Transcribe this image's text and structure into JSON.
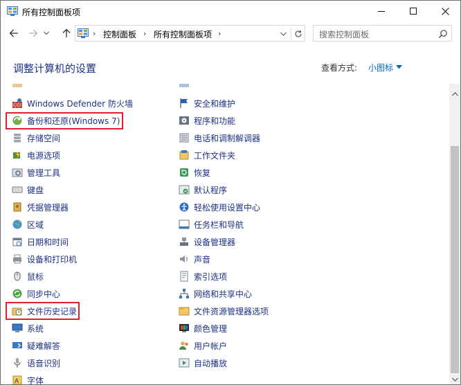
{
  "window": {
    "title": "所有控制面板项"
  },
  "address": {
    "crumbs": [
      "控制面板",
      "所有控制面板项"
    ],
    "search_placeholder": "搜索控制面板"
  },
  "header": {
    "heading": "调整计算机的设置",
    "view_by_label": "查看方式:",
    "view_by_value": "小图标"
  },
  "items_left": [
    {
      "label": "Windows Defender 防火墙",
      "icon": "firewall-icon"
    },
    {
      "label": "备份和还原(Windows 7)",
      "icon": "backup-restore-icon"
    },
    {
      "label": "存储空间",
      "icon": "storage-spaces-icon"
    },
    {
      "label": "电源选项",
      "icon": "power-options-icon"
    },
    {
      "label": "管理工具",
      "icon": "admin-tools-icon"
    },
    {
      "label": "键盘",
      "icon": "keyboard-icon"
    },
    {
      "label": "凭据管理器",
      "icon": "credential-manager-icon"
    },
    {
      "label": "区域",
      "icon": "region-icon"
    },
    {
      "label": "日期和时间",
      "icon": "date-time-icon"
    },
    {
      "label": "设备和打印机",
      "icon": "devices-printers-icon"
    },
    {
      "label": "鼠标",
      "icon": "mouse-icon"
    },
    {
      "label": "同步中心",
      "icon": "sync-center-icon"
    },
    {
      "label": "文件历史记录",
      "icon": "file-history-icon"
    },
    {
      "label": "系统",
      "icon": "system-icon"
    },
    {
      "label": "疑难解答",
      "icon": "troubleshooting-icon"
    },
    {
      "label": "语音识别",
      "icon": "speech-recognition-icon"
    },
    {
      "label": "字体",
      "icon": "fonts-icon"
    }
  ],
  "items_right": [
    {
      "label": "安全和维护",
      "icon": "security-maintenance-icon"
    },
    {
      "label": "程序和功能",
      "icon": "programs-features-icon"
    },
    {
      "label": "电话和调制解调器",
      "icon": "phone-modem-icon"
    },
    {
      "label": "工作文件夹",
      "icon": "work-folders-icon"
    },
    {
      "label": "恢复",
      "icon": "recovery-icon"
    },
    {
      "label": "默认程序",
      "icon": "default-programs-icon"
    },
    {
      "label": "轻松使用设置中心",
      "icon": "ease-of-access-icon"
    },
    {
      "label": "任务栏和导航",
      "icon": "taskbar-navigation-icon"
    },
    {
      "label": "设备管理器",
      "icon": "device-manager-icon"
    },
    {
      "label": "声音",
      "icon": "sound-icon"
    },
    {
      "label": "索引选项",
      "icon": "indexing-options-icon"
    },
    {
      "label": "网络和共享中心",
      "icon": "network-sharing-icon"
    },
    {
      "label": "文件资源管理器选项",
      "icon": "file-explorer-options-icon"
    },
    {
      "label": "颜色管理",
      "icon": "color-management-icon"
    },
    {
      "label": "用户帐户",
      "icon": "user-accounts-icon"
    },
    {
      "label": "自动播放",
      "icon": "autoplay-icon"
    }
  ],
  "colors": {
    "link": "#1e3287",
    "accent": "#0066cc",
    "highlight": "#e0202a"
  }
}
